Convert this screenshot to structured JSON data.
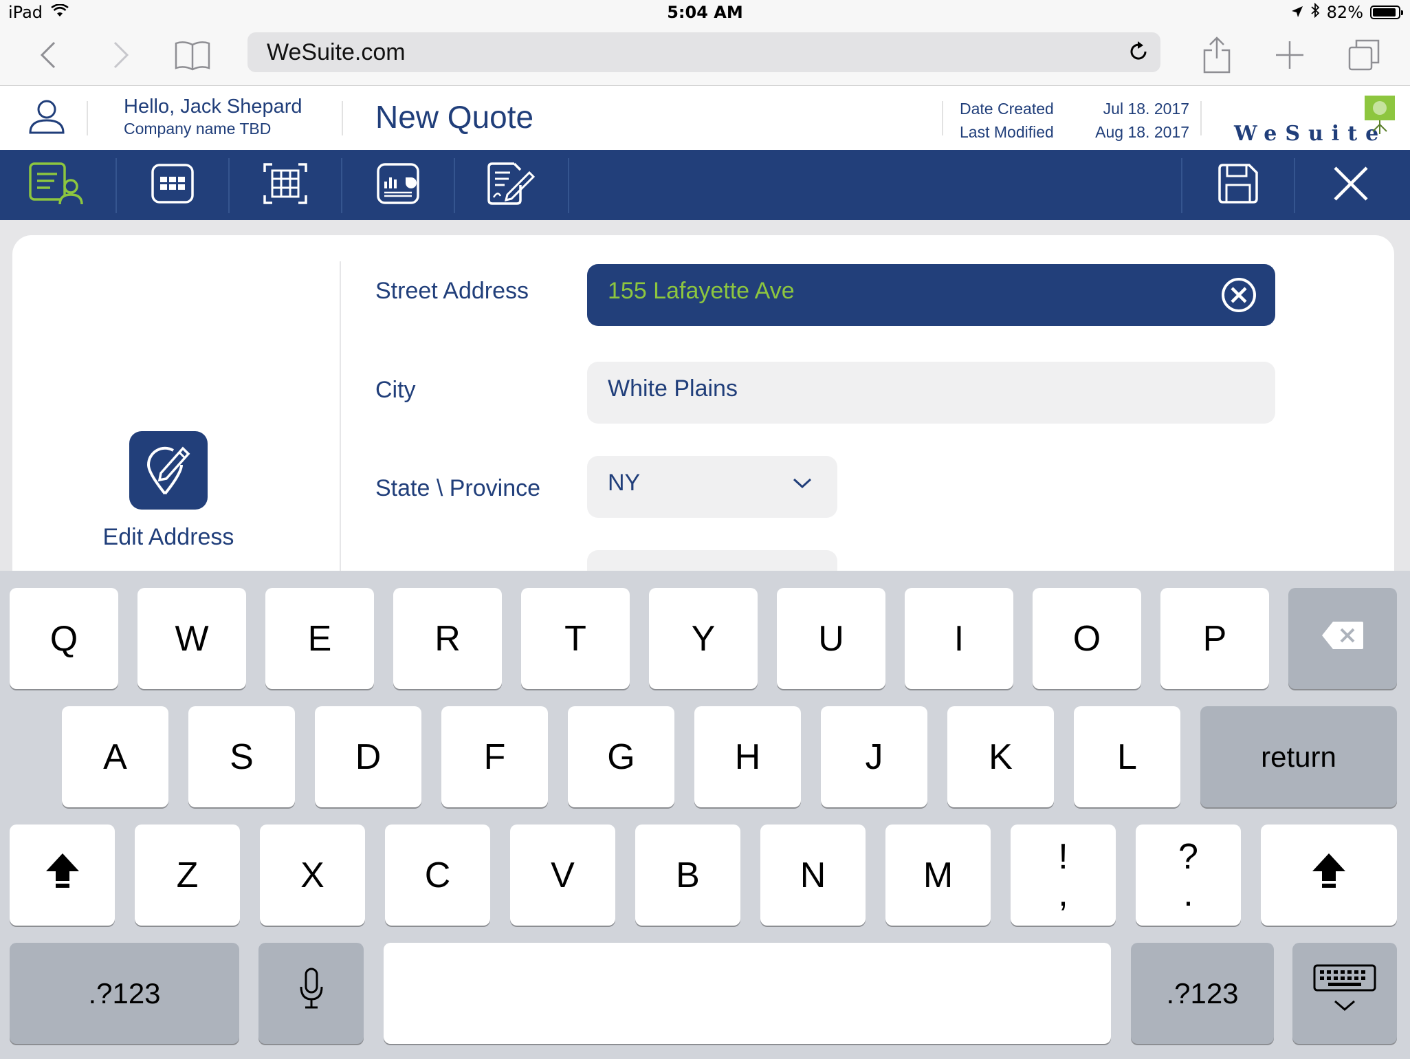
{
  "status_bar": {
    "device": "iPad",
    "time": "5:04 AM",
    "battery": "82%",
    "battery_level": 0.82
  },
  "browser": {
    "url": "WeSuite.com"
  },
  "header": {
    "greeting": "Hello, Jack Shepard",
    "company": "Company name TBD",
    "title": "New Quote",
    "date_created_label": "Date Created",
    "date_created_value": "Jul 18. 2017",
    "last_modified_label": "Last Modified",
    "last_modified_value": "Aug 18. 2017",
    "logo_text": "WeSuite"
  },
  "toolbar": {
    "items": [
      "customer-info-icon",
      "grid-apps-icon",
      "spreadsheet-icon",
      "report-chart-icon",
      "sign-document-icon"
    ],
    "save_icon": "save-icon",
    "close_icon": "close-icon",
    "active_color": "#8dc63f",
    "bar_color": "#223f7a"
  },
  "form": {
    "side_action": "Edit Address",
    "fields": [
      {
        "label": "Street Address",
        "value": "155 Lafayette Ave"
      },
      {
        "label": "City",
        "value": "White Plains"
      },
      {
        "label": "State \\ Province",
        "value": "NY"
      }
    ]
  },
  "keyboard": {
    "row1": [
      "Q",
      "W",
      "E",
      "R",
      "T",
      "Y",
      "U",
      "I",
      "O",
      "P"
    ],
    "row2": [
      "A",
      "S",
      "D",
      "F",
      "G",
      "H",
      "J",
      "K",
      "L"
    ],
    "return": "return",
    "row3": [
      "Z",
      "X",
      "C",
      "V",
      "B",
      "N",
      "M"
    ],
    "punct1_top": "!",
    "punct1_bottom": ",",
    "punct2_top": "?",
    "punct2_bottom": ".",
    "numbers_left": ".?123",
    "numbers_right": ".?123"
  }
}
